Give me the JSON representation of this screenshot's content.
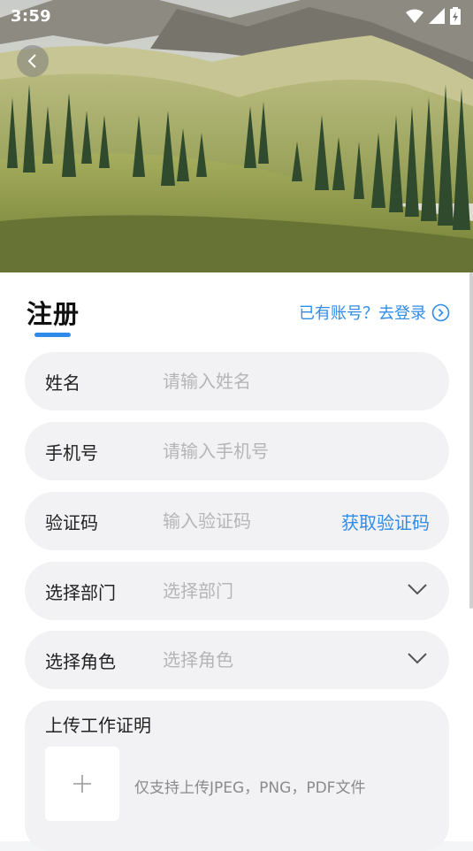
{
  "status_bar": {
    "time": "3:59"
  },
  "header": {
    "title": "注册",
    "login_link": "已有账号？去登录"
  },
  "form": {
    "name": {
      "label": "姓名",
      "placeholder": "请输入姓名"
    },
    "phone": {
      "label": "手机号",
      "placeholder": "请输入手机号"
    },
    "code": {
      "label": "验证码",
      "placeholder": "输入验证码",
      "action": "获取验证码"
    },
    "department": {
      "label": "选择部门",
      "placeholder": "选择部门"
    },
    "role": {
      "label": "选择角色",
      "placeholder": "选择角色"
    }
  },
  "upload": {
    "title": "上传工作证明",
    "hint": "仅支持上传JPEG，PNG，PDF文件"
  },
  "colors": {
    "accent": "#2f8bea",
    "field_bg": "#f2f2f4"
  },
  "icons": {
    "back": "chevron-left-icon",
    "login": "arrow-circle-right-icon",
    "dropdown": "chevron-down-icon",
    "add": "plus-icon"
  }
}
